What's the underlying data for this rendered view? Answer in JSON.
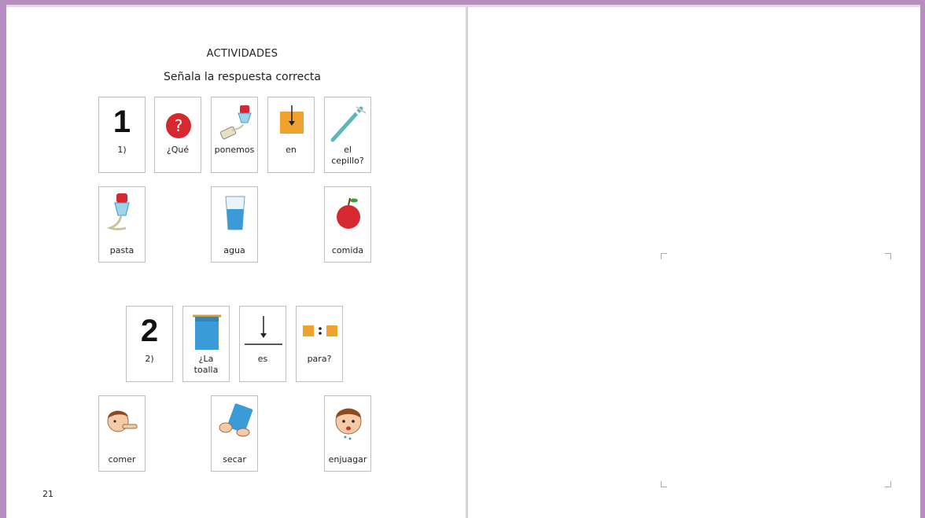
{
  "heading": "ACTIVIDADES",
  "instruction": "Señala la respuesta correcta",
  "page_number": "21",
  "question1": {
    "number": "1",
    "cards": [
      {
        "label": "1)",
        "icon": "number-1-icon"
      },
      {
        "label": "¿Qué",
        "icon": "question-icon"
      },
      {
        "label": "ponemos",
        "icon": "put-paste-icon"
      },
      {
        "label": "en",
        "icon": "in-arrow-icon"
      },
      {
        "label": "el cepillo?",
        "icon": "toothbrush-icon"
      }
    ],
    "answers": [
      {
        "label": "pasta",
        "icon": "toothpaste-icon"
      },
      {
        "label": "agua",
        "icon": "water-glass-icon"
      },
      {
        "label": "comida",
        "icon": "apple-icon"
      }
    ]
  },
  "question2": {
    "number": "2",
    "cards": [
      {
        "label": "2)",
        "icon": "number-2-icon"
      },
      {
        "label": "¿La toalla",
        "icon": "towel-icon"
      },
      {
        "label": "es",
        "icon": "is-arrow-icon"
      },
      {
        "label": "para?",
        "icon": "for-squares-icon"
      }
    ],
    "answers": [
      {
        "label": "comer",
        "icon": "eating-boy-icon"
      },
      {
        "label": "secar",
        "icon": "drying-hands-icon"
      },
      {
        "label": "enjuagar",
        "icon": "rinsing-boy-icon"
      }
    ]
  },
  "colors": {
    "frame": "#b88ec0",
    "card_border": "#bfbfbf",
    "red": "#d7282f",
    "orange": "#f0a22e",
    "blue": "#3a9bd8",
    "teal": "#5bb8b6"
  }
}
